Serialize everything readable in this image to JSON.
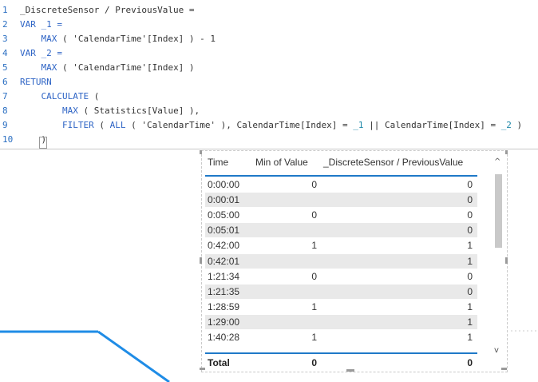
{
  "editor": {
    "lines": [
      {
        "num": "1",
        "tokens": [
          {
            "t": "_DiscreteSensor / PreviousValue =",
            "c": ""
          }
        ]
      },
      {
        "num": "2",
        "tokens": [
          {
            "t": "VAR _1 =",
            "c": "kw"
          }
        ]
      },
      {
        "num": "3",
        "tokens": [
          {
            "t": "    MAX",
            "c": "kw"
          },
          {
            "t": " ( ",
            "c": ""
          },
          {
            "t": "'CalendarTime'[Index]",
            "c": ""
          },
          {
            "t": " ) - 1",
            "c": ""
          }
        ]
      },
      {
        "num": "4",
        "tokens": [
          {
            "t": "VAR _2 =",
            "c": "kw"
          }
        ]
      },
      {
        "num": "5",
        "tokens": [
          {
            "t": "    MAX",
            "c": "kw"
          },
          {
            "t": " ( ",
            "c": ""
          },
          {
            "t": "'CalendarTime'[Index]",
            "c": ""
          },
          {
            "t": " )",
            "c": ""
          }
        ]
      },
      {
        "num": "6",
        "tokens": [
          {
            "t": "RETURN",
            "c": "kw"
          }
        ]
      },
      {
        "num": "7",
        "tokens": [
          {
            "t": "    CALCULATE",
            "c": "kw"
          },
          {
            "t": " (",
            "c": ""
          }
        ]
      },
      {
        "num": "8",
        "tokens": [
          {
            "t": "        MAX",
            "c": "kw"
          },
          {
            "t": " ( Statistics[Value] ),",
            "c": ""
          }
        ]
      },
      {
        "num": "9",
        "tokens": [
          {
            "t": "        FILTER",
            "c": "kw"
          },
          {
            "t": " ( ",
            "c": ""
          },
          {
            "t": "ALL",
            "c": "kw"
          },
          {
            "t": " ( ",
            "c": ""
          },
          {
            "t": "'CalendarTime'",
            "c": ""
          },
          {
            "t": " ), CalendarTime[Index] = ",
            "c": ""
          },
          {
            "t": "_1",
            "c": "var"
          },
          {
            "t": " || CalendarTime[Index] = ",
            "c": ""
          },
          {
            "t": "_2",
            "c": "var"
          },
          {
            "t": " )",
            "c": ""
          }
        ]
      },
      {
        "num": "10",
        "tokens": [
          {
            "t": "    )",
            "c": ""
          }
        ]
      }
    ]
  },
  "table": {
    "headers": {
      "time": "Time",
      "min": "Min of Value",
      "prev": "_DiscreteSensor / PreviousValue"
    },
    "rows": [
      {
        "time": "0:00:00",
        "min": "0",
        "prev": "0"
      },
      {
        "time": "0:00:01",
        "min": "",
        "prev": "0"
      },
      {
        "time": "0:05:00",
        "min": "0",
        "prev": "0"
      },
      {
        "time": "0:05:01",
        "min": "",
        "prev": "0"
      },
      {
        "time": "0:42:00",
        "min": "1",
        "prev": "1"
      },
      {
        "time": "0:42:01",
        "min": "",
        "prev": "1"
      },
      {
        "time": "1:21:34",
        "min": "0",
        "prev": "0"
      },
      {
        "time": "1:21:35",
        "min": "",
        "prev": "0"
      },
      {
        "time": "1:28:59",
        "min": "1",
        "prev": "1"
      },
      {
        "time": "1:29:00",
        "min": "",
        "prev": "1"
      },
      {
        "time": "1:40:28",
        "min": "1",
        "prev": "1"
      }
    ],
    "total": {
      "label": "Total",
      "min": "0",
      "prev": "0"
    }
  },
  "scroll": {
    "up_icon": "chevron-up-icon",
    "down_icon": "chevron-down-icon",
    "up_glyph": "^",
    "down_glyph": "v"
  },
  "colors": {
    "accent": "#1f79c8",
    "keyword": "#2e64c5",
    "line_number": "#2b6fc2",
    "row_alt": "#e9e9e9"
  }
}
